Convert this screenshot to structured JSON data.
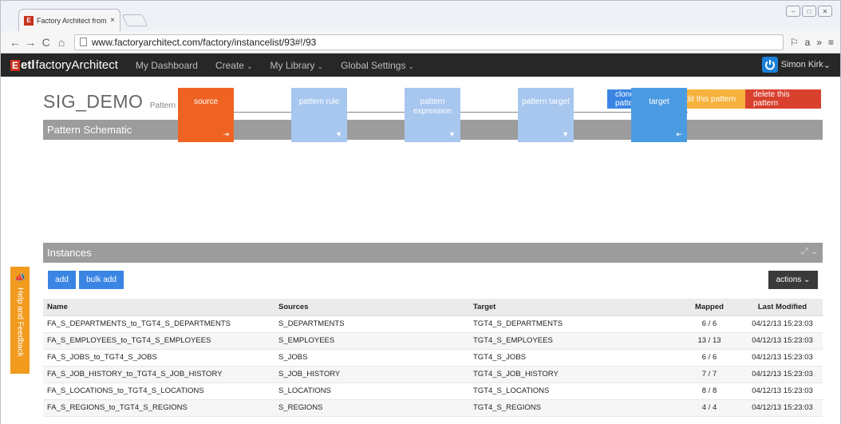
{
  "browser": {
    "tab_title": "Factory Architect from ETL",
    "tab_close": "×",
    "url": "www.factoryarchitect.com/factory/instancelist/93#!/93",
    "window_buttons": [
      "–",
      "□",
      "✕"
    ],
    "nav": [
      "←",
      "→",
      "C",
      "⌂"
    ],
    "extensions": [
      "⚐",
      "a",
      "»",
      "≡"
    ]
  },
  "app": {
    "logo_mark": "E",
    "logo_etl": "etl",
    "logo_fa": "factoryArchitect",
    "nav": [
      {
        "label": "My Dashboard"
      },
      {
        "label": "Create",
        "chev": "⌄"
      },
      {
        "label": "My Library",
        "chev": "⌄"
      },
      {
        "label": "Global Settings",
        "chev": "⌄"
      }
    ],
    "user": "Simon Kirk",
    "user_chev": "⌄"
  },
  "page": {
    "title": "SIG_DEMO",
    "subtitle": "Pattern Dashboard",
    "buttons": {
      "clone": "clone pattern",
      "edit": "edit this pattern",
      "delete": "delete this pattern"
    }
  },
  "schematic": {
    "heading": "Pattern Schematic",
    "nodes": [
      {
        "label": "source",
        "icon": "⇥"
      },
      {
        "label": "pattern rule",
        "icon": "▼"
      },
      {
        "label": "pattern expression",
        "icon": "▼"
      },
      {
        "label": "pattern target",
        "icon": "▼"
      },
      {
        "label": "target",
        "icon": "⇤"
      }
    ]
  },
  "instances": {
    "heading": "Instances",
    "controls": "⤢ ⌄",
    "add": "add",
    "bulk_add": "bulk add",
    "actions": "actions ⌄",
    "columns": [
      "Name",
      "Sources",
      "Target",
      "Mapped",
      "Last Modified"
    ],
    "rows": [
      [
        "FA_S_DEPARTMENTS_to_TGT4_S_DEPARTMENTS",
        "S_DEPARTMENTS",
        "TGT4_S_DEPARTMENTS",
        "6 / 6",
        "04/12/13 15:23:03"
      ],
      [
        "FA_S_EMPLOYEES_to_TGT4_S_EMPLOYEES",
        "S_EMPLOYEES",
        "TGT4_S_EMPLOYEES",
        "13 / 13",
        "04/12/13 15:23:03"
      ],
      [
        "FA_S_JOBS_to_TGT4_S_JOBS",
        "S_JOBS",
        "TGT4_S_JOBS",
        "6 / 6",
        "04/12/13 15:23:03"
      ],
      [
        "FA_S_JOB_HISTORY_to_TGT4_S_JOB_HISTORY",
        "S_JOB_HISTORY",
        "TGT4_S_JOB_HISTORY",
        "7 / 7",
        "04/12/13 15:23:03"
      ],
      [
        "FA_S_LOCATIONS_to_TGT4_S_LOCATIONS",
        "S_LOCATIONS",
        "TGT4_S_LOCATIONS",
        "8 / 8",
        "04/12/13 15:23:03"
      ],
      [
        "FA_S_REGIONS_to_TGT4_S_REGIONS",
        "S_REGIONS",
        "TGT4_S_REGIONS",
        "4 / 4",
        "04/12/13 15:23:03"
      ]
    ]
  },
  "help": {
    "label": "Help and Feedback",
    "icon": "📣"
  }
}
